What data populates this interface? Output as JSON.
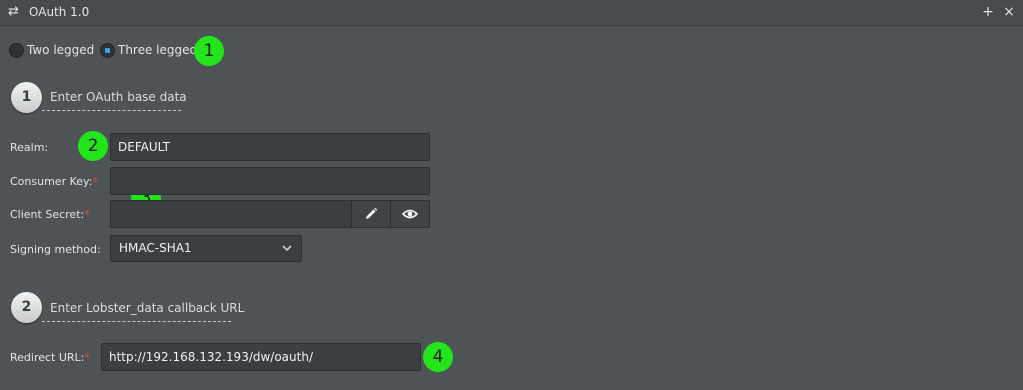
{
  "window": {
    "title": "OAuth 1.0",
    "plus_glyph": "+",
    "close_glyph": "×"
  },
  "mode": {
    "options": [
      {
        "label": "Two legged",
        "checked": false
      },
      {
        "label": "Three legged",
        "checked": true
      }
    ]
  },
  "markers": [
    "1",
    "2",
    "3",
    "4"
  ],
  "step1": {
    "number": "1",
    "title": "Enter OAuth base data"
  },
  "form": {
    "realm_label": "Realm:",
    "realm_value": "DEFAULT",
    "consumer_key_label": "Consumer Key:",
    "consumer_key_value": "",
    "client_secret_label": "Client Secret:",
    "client_secret_value": "",
    "required_mark": "*",
    "signing_method_label": "Signing method:",
    "signing_method_value": "HMAC-SHA1"
  },
  "step2": {
    "number": "2",
    "title": "Enter Lobster_data callback URL"
  },
  "callback": {
    "redirect_label": "Redirect URL:",
    "redirect_value": "http://192.168.132.193/dw/oauth/"
  },
  "colors": {
    "background": "#4e5456",
    "marker": "#22e51c",
    "radio_selected": "#3aa3e0",
    "required": "#e0453f"
  }
}
